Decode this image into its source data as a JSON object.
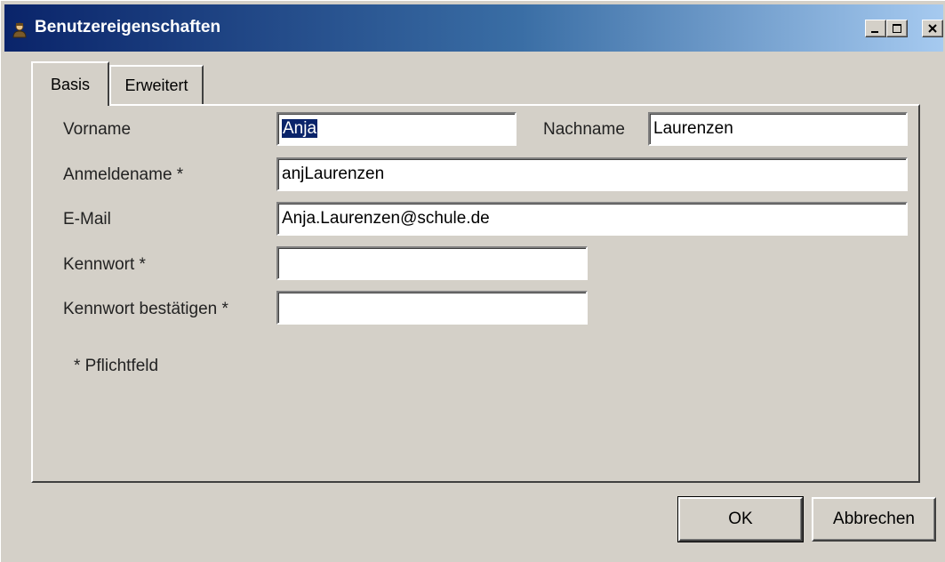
{
  "window": {
    "title": "Benutzereigenschaften",
    "icon": "user-icon",
    "controls": {
      "minimize": "minimize-icon",
      "maximize": "maximize-icon",
      "close": "close-icon"
    }
  },
  "tabs": [
    {
      "label": "Basis",
      "active": true
    },
    {
      "label": "Erweitert",
      "active": false
    }
  ],
  "form": {
    "vorname": {
      "label": "Vorname",
      "value": "Anja"
    },
    "nachname": {
      "label": "Nachname",
      "value": "Laurenzen"
    },
    "anmeldename": {
      "label": "Anmeldename *",
      "value": "anjLaurenzen"
    },
    "email": {
      "label": "E-Mail",
      "value": "Anja.Laurenzen@schule.de"
    },
    "kennwort": {
      "label": "Kennwort *",
      "value": ""
    },
    "kennwort_bestaetigen": {
      "label": "Kennwort bestätigen *",
      "value": ""
    },
    "footnote": "* Pflichtfeld"
  },
  "buttons": {
    "ok": "OK",
    "cancel": "Abbrechen"
  },
  "colors": {
    "titlebar_start": "#0a246a",
    "titlebar_end": "#a6caf0",
    "face": "#d4d0c8",
    "selection": "#0a246a"
  }
}
